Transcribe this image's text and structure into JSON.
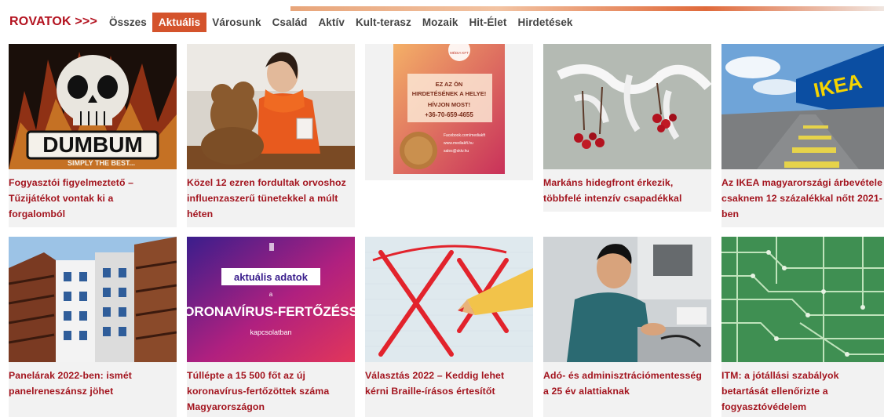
{
  "nav": {
    "heading": "ROVATOK >>>",
    "tabs": [
      "Összes",
      "Aktuális",
      "Városunk",
      "Család",
      "Aktív",
      "Kult-terasz",
      "Mozaik",
      "Hit-Élet",
      "Hirdetések"
    ],
    "active_tab": "Aktuális"
  },
  "articles": [
    {
      "title": "Fogyasztói figyelmeztető –\nTűzijátékot vontak ki a\nforgalomból",
      "image_text": "DUMBUM",
      "image_subtext": "SIMPLY THE BEST..."
    },
    {
      "title": "Közel 12 ezren fordultak orvoshoz\ninfluenzaszerű tünetekkel a múlt\nhéten"
    },
    {
      "is_ad": true,
      "ad_lines": [
        "EZ AZ ÖN",
        "HIRDETÉSÉNEK A HELYE!",
        "HÍVJON MOST!",
        "+36-70-659-4655"
      ],
      "ad_logo": "MÉDIA KFT",
      "ad_contacts": [
        "Facebook.com/mediakft",
        "www.mediakft.hu",
        "sales@sktv.hu"
      ]
    },
    {
      "title": "Markáns hidegfront érkezik,\ntöbbfelé intenzív csapadékkal"
    },
    {
      "title": "Az IKEA magyarországi árbevétele\ncsaknem 12 százalékkal nőtt 2021-\nben",
      "image_text": "IKEA"
    },
    {
      "title": "Panelárak 2022-ben: ismét\npanelreneszánsz jöhet"
    },
    {
      "title": "Túllépte a 15 500 főt az új\nkoronavírus-fertőzöttek száma\nMagyarországon",
      "image_label": "aktuális adatok",
      "image_small": "a",
      "image_main": "ORONAVÍRUS-FERTŐZÉSS",
      "image_foot": "kapcsolatban"
    },
    {
      "title": "Választás 2022 – Keddig lehet\nkérni Braille-írásos értesítőt"
    },
    {
      "title": "Adó- és adminisztrációmentesség\na 25 év alattiaknak"
    },
    {
      "title": "ITM: a jótállási szabályok\nbetartását ellenőrizte a\nfogyasztóvédelem"
    }
  ]
}
